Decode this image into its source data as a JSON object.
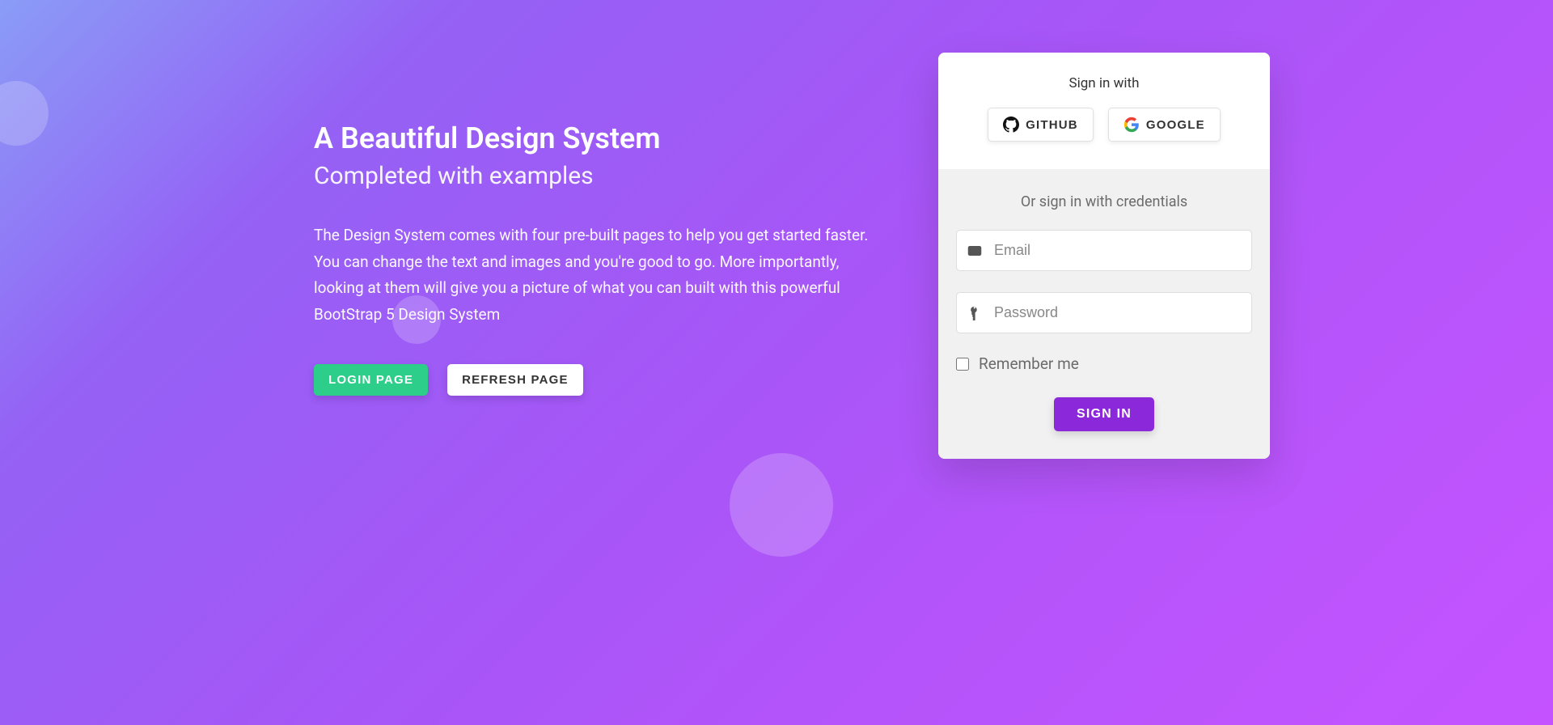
{
  "hero": {
    "title": "A Beautiful Design System",
    "subtitle": "Completed with examples",
    "description": "The Design System comes with four pre-built pages to help you get started faster. You can change the text and images and you're good to go. More importantly, looking at them will give you a picture of what you can built with this powerful BootStrap 5 Design System",
    "login_button": "LOGIN PAGE",
    "refresh_button": "REFRESH PAGE"
  },
  "login_card": {
    "sign_in_with": "Sign in with",
    "github": "GITHUB",
    "google": "GOOGLE",
    "credentials_text": "Or sign in with credentials",
    "email_placeholder": "Email",
    "password_placeholder": "Password",
    "remember_label": "Remember me",
    "sign_in_button": "SIGN IN"
  }
}
